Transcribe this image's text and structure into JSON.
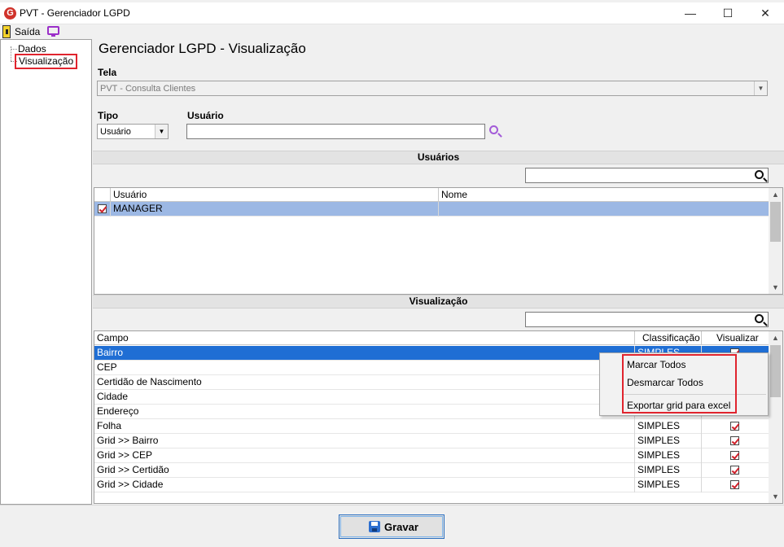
{
  "window": {
    "title": "PVT - Gerenciador LGPD",
    "logo_letter": "G"
  },
  "window_buttons": {
    "minimize": "—",
    "maximize": "☐",
    "close": "✕"
  },
  "menubar": {
    "exit_label": "Saída"
  },
  "tree": {
    "items": [
      {
        "label": "Dados"
      },
      {
        "label": "Visualização"
      }
    ]
  },
  "page": {
    "title": "Gerenciador LGPD - Visualização"
  },
  "form": {
    "tela_label": "Tela",
    "tela_value": "PVT - Consulta Clientes",
    "tipo_label": "Tipo",
    "tipo_value": "Usuário",
    "usuario_label": "Usuário",
    "usuario_value": ""
  },
  "usuarios_section": {
    "title": "Usuários",
    "search_value": "",
    "columns": [
      "Usuário",
      "Nome"
    ],
    "rows": [
      {
        "checked": true,
        "usuario": "MANAGER",
        "nome": ""
      }
    ]
  },
  "visualizacao_section": {
    "title": "Visualização",
    "search_value": "",
    "columns": [
      "Campo",
      "Classificação",
      "Visualizar"
    ],
    "rows": [
      {
        "campo": "Bairro",
        "classificacao": "SIMPLES",
        "visualizar": true
      },
      {
        "campo": "CEP",
        "classificacao": "",
        "visualizar": true
      },
      {
        "campo": "Certidão de Nascimento",
        "classificacao": "",
        "visualizar": true
      },
      {
        "campo": "Cidade",
        "classificacao": "",
        "visualizar": true
      },
      {
        "campo": "Endereço",
        "classificacao": "",
        "visualizar": true
      },
      {
        "campo": "Folha",
        "classificacao": "SIMPLES",
        "visualizar": true
      },
      {
        "campo": "Grid >> Bairro",
        "classificacao": "SIMPLES",
        "visualizar": true
      },
      {
        "campo": "Grid >> CEP",
        "classificacao": "SIMPLES",
        "visualizar": true
      },
      {
        "campo": "Grid >> Certidão",
        "classificacao": "SIMPLES",
        "visualizar": true
      },
      {
        "campo": "Grid >> Cidade",
        "classificacao": "SIMPLES",
        "visualizar": true
      }
    ]
  },
  "context_menu": {
    "items": [
      "Marcar Todos",
      "Desmarcar Todos",
      "Exportar grid para excel"
    ]
  },
  "footer": {
    "save_label": "Gravar"
  },
  "colors": {
    "highlight_red": "#e0242e",
    "selection_blue": "#1f6ed4",
    "selection_light": "#9cb8e4",
    "accent_purple": "#9b2fc9"
  }
}
